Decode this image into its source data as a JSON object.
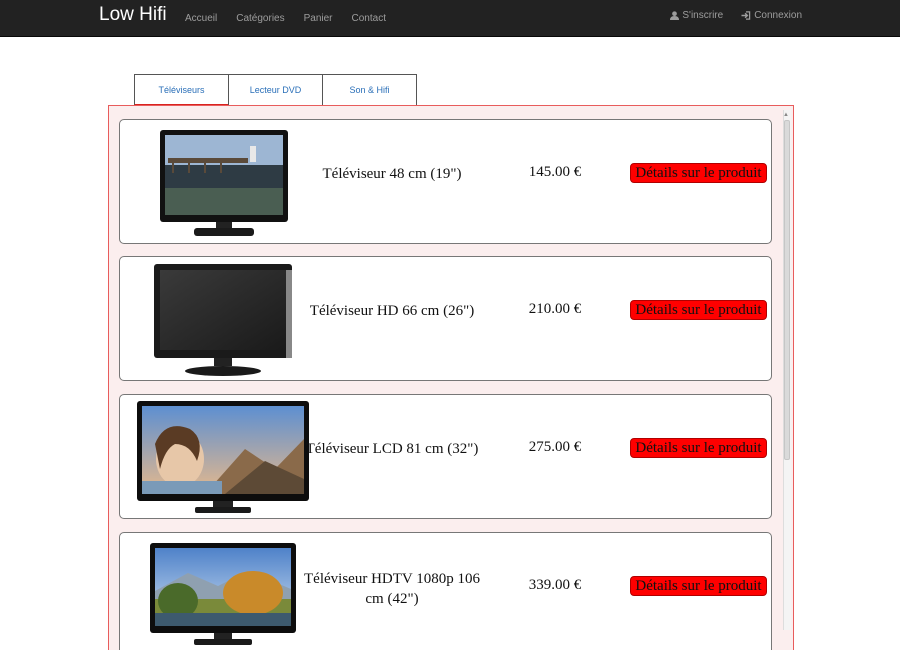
{
  "navbar": {
    "brand": "Low Hifi",
    "links": [
      "Accueil",
      "Catégories",
      "Panier",
      "Contact"
    ],
    "signup": "S'inscrire",
    "login": "Connexion"
  },
  "tabs": [
    {
      "label": "Téléviseurs",
      "active": true
    },
    {
      "label": "Lecteur DVD",
      "active": false
    },
    {
      "label": "Son & Hifi",
      "active": false
    }
  ],
  "products": [
    {
      "name": "Téléviseur 48 cm (19\")",
      "price": "145.00 €",
      "button": "Détails sur le produit",
      "screen": "lake-pier"
    },
    {
      "name": "Téléviseur HD 66 cm (26\")",
      "price": "210.00 €",
      "button": "Détails sur le produit",
      "screen": "blank"
    },
    {
      "name": "Téléviseur LCD 81 cm (32\")",
      "price": "275.00 €",
      "button": "Détails sur le produit",
      "screen": "girl-mountains"
    },
    {
      "name": "Téléviseur HDTV 1080p 106 cm (42\")",
      "price": "339.00 €",
      "button": "Détails sur le produit",
      "screen": "autumn-landscape"
    }
  ],
  "colors": {
    "navbar": "#222222",
    "accent": "#ff0000",
    "panel_border": "#e85c5c",
    "link": "#2a6fb8"
  }
}
